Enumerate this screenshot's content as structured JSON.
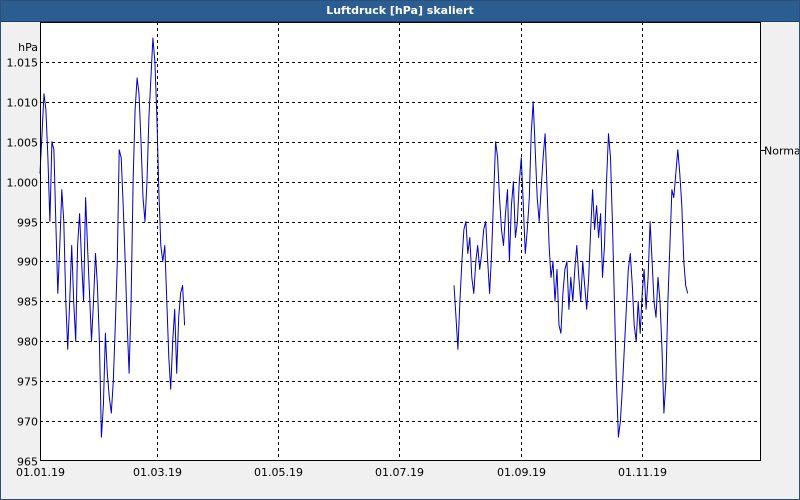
{
  "window": {
    "title": "Luftdruck [hPa] skaliert"
  },
  "colors": {
    "line": "#0000c8",
    "grid": "#000000",
    "titlebar": "#2b5d91",
    "plot_background": "#ffffff",
    "window_background": "#f0f0f0"
  },
  "chart_data": {
    "type": "line",
    "title": "Luftdruck [hPa] skaliert",
    "ylabel": "hPa",
    "xlabel": "",
    "ylim": [
      965,
      1020
    ],
    "xlim": [
      "2019-01-01",
      "2019-12-31"
    ],
    "grid": true,
    "x_ticks": [
      "01.01.19",
      "01.03.19",
      "01.05.19",
      "01.07.19",
      "01.09.19",
      "01.11.19"
    ],
    "y_ticks": [
      "965",
      "970",
      "975",
      "980",
      "985",
      "990",
      "995",
      "1.000",
      "1.005",
      "1.010",
      "1.015"
    ],
    "reference_lines": [
      {
        "label": "Normal",
        "value": 1004
      }
    ],
    "series": [
      {
        "values": [
          [
            [
              "2019-01-01",
              1001
            ],
            [
              "2019-01-02",
              1006
            ],
            [
              "2019-01-03",
              1011
            ],
            [
              "2019-01-04",
              1009
            ],
            [
              "2019-01-05",
              1003
            ],
            [
              "2019-01-06",
              995
            ],
            [
              "2019-01-07",
              1005
            ],
            [
              "2019-01-08",
              1004
            ],
            [
              "2019-01-09",
              995
            ],
            [
              "2019-01-10",
              986
            ],
            [
              "2019-01-11",
              992
            ],
            [
              "2019-01-12",
              999
            ],
            [
              "2019-01-13",
              995
            ],
            [
              "2019-01-14",
              985
            ],
            [
              "2019-01-15",
              979
            ],
            [
              "2019-01-16",
              985
            ],
            [
              "2019-01-17",
              992
            ],
            [
              "2019-01-18",
              985
            ],
            [
              "2019-01-19",
              980
            ],
            [
              "2019-01-20",
              992
            ],
            [
              "2019-01-21",
              996
            ],
            [
              "2019-01-22",
              990
            ],
            [
              "2019-01-23",
              985
            ],
            [
              "2019-01-24",
              998
            ],
            [
              "2019-01-25",
              992
            ],
            [
              "2019-01-26",
              986
            ],
            [
              "2019-01-27",
              980
            ],
            [
              "2019-01-28",
              985
            ],
            [
              "2019-01-29",
              991
            ],
            [
              "2019-01-30",
              987
            ],
            [
              "2019-01-31",
              980
            ],
            [
              "2019-02-01",
              968
            ],
            [
              "2019-02-02",
              972
            ],
            [
              "2019-02-03",
              981
            ],
            [
              "2019-02-04",
              976
            ],
            [
              "2019-02-05",
              973
            ],
            [
              "2019-02-06",
              971
            ],
            [
              "2019-02-07",
              975
            ],
            [
              "2019-02-08",
              982
            ],
            [
              "2019-02-09",
              990
            ],
            [
              "2019-02-10",
              1004
            ],
            [
              "2019-02-11",
              1003
            ],
            [
              "2019-02-12",
              997
            ],
            [
              "2019-02-13",
              990
            ],
            [
              "2019-02-14",
              982
            ],
            [
              "2019-02-15",
              976
            ],
            [
              "2019-02-16",
              985
            ],
            [
              "2019-02-17",
              1000
            ],
            [
              "2019-02-18",
              1009
            ],
            [
              "2019-02-19",
              1013
            ],
            [
              "2019-02-20",
              1011
            ],
            [
              "2019-02-21",
              1005
            ],
            [
              "2019-02-22",
              998
            ],
            [
              "2019-02-23",
              995
            ],
            [
              "2019-02-24",
              1000
            ],
            [
              "2019-02-25",
              1008
            ],
            [
              "2019-02-26",
              1013
            ],
            [
              "2019-02-27",
              1018
            ],
            [
              "2019-02-28",
              1015
            ],
            [
              "2019-03-01",
              1008
            ],
            [
              "2019-03-02",
              999
            ],
            [
              "2019-03-03",
              992
            ],
            [
              "2019-03-04",
              990
            ],
            [
              "2019-03-05",
              992
            ],
            [
              "2019-03-06",
              985
            ],
            [
              "2019-03-07",
              978
            ],
            [
              "2019-03-08",
              974
            ],
            [
              "2019-03-09",
              980
            ],
            [
              "2019-03-10",
              984
            ],
            [
              "2019-03-11",
              976
            ],
            [
              "2019-03-12",
              983
            ],
            [
              "2019-03-13",
              986
            ],
            [
              "2019-03-14",
              987
            ],
            [
              "2019-03-15",
              982
            ]
          ],
          [
            [
              "2019-07-29",
              987
            ],
            [
              "2019-07-30",
              983
            ],
            [
              "2019-07-31",
              979
            ],
            [
              "2019-08-01",
              985
            ],
            [
              "2019-08-02",
              990
            ],
            [
              "2019-08-03",
              994
            ],
            [
              "2019-08-04",
              995
            ],
            [
              "2019-08-05",
              991
            ],
            [
              "2019-08-06",
              993
            ],
            [
              "2019-08-07",
              988
            ],
            [
              "2019-08-08",
              986
            ],
            [
              "2019-08-09",
              990
            ],
            [
              "2019-08-10",
              992
            ],
            [
              "2019-08-11",
              989
            ],
            [
              "2019-08-12",
              991
            ],
            [
              "2019-08-13",
              994
            ],
            [
              "2019-08-14",
              995
            ],
            [
              "2019-08-15",
              990
            ],
            [
              "2019-08-16",
              986
            ],
            [
              "2019-08-17",
              991
            ],
            [
              "2019-08-18",
              998
            ],
            [
              "2019-08-19",
              1005
            ],
            [
              "2019-08-20",
              1003
            ],
            [
              "2019-08-21",
              998
            ],
            [
              "2019-08-22",
              994
            ],
            [
              "2019-08-23",
              992
            ],
            [
              "2019-08-24",
              996
            ],
            [
              "2019-08-25",
              999
            ],
            [
              "2019-08-26",
              990
            ],
            [
              "2019-08-27",
              997
            ],
            [
              "2019-08-28",
              1000
            ],
            [
              "2019-08-29",
              993
            ],
            [
              "2019-08-30",
              995
            ],
            [
              "2019-08-31",
              1000
            ],
            [
              "2019-09-01",
              1003
            ],
            [
              "2019-09-02",
              997
            ],
            [
              "2019-09-03",
              991
            ],
            [
              "2019-09-04",
              994
            ],
            [
              "2019-09-05",
              998
            ],
            [
              "2019-09-06",
              1006
            ],
            [
              "2019-09-07",
              1010
            ],
            [
              "2019-09-08",
              1004
            ],
            [
              "2019-09-09",
              998
            ],
            [
              "2019-09-10",
              995
            ],
            [
              "2019-09-11",
              999
            ],
            [
              "2019-09-12",
              1003
            ],
            [
              "2019-09-13",
              1006
            ],
            [
              "2019-09-14",
              999
            ],
            [
              "2019-09-15",
              992
            ],
            [
              "2019-09-16",
              988
            ],
            [
              "2019-09-17",
              990
            ],
            [
              "2019-09-18",
              985
            ],
            [
              "2019-09-19",
              989
            ],
            [
              "2019-09-20",
              982
            ],
            [
              "2019-09-21",
              981
            ],
            [
              "2019-09-22",
              986
            ],
            [
              "2019-09-23",
              989
            ],
            [
              "2019-09-24",
              990
            ],
            [
              "2019-09-25",
              984
            ],
            [
              "2019-09-26",
              988
            ],
            [
              "2019-09-27",
              985
            ],
            [
              "2019-09-28",
              989
            ],
            [
              "2019-09-29",
              992
            ],
            [
              "2019-09-30",
              988
            ],
            [
              "2019-10-01",
              985
            ],
            [
              "2019-10-02",
              990
            ],
            [
              "2019-10-03",
              987
            ],
            [
              "2019-10-04",
              984
            ],
            [
              "2019-10-05",
              988
            ],
            [
              "2019-10-06",
              994
            ],
            [
              "2019-10-07",
              999
            ],
            [
              "2019-10-08",
              994
            ],
            [
              "2019-10-09",
              997
            ],
            [
              "2019-10-10",
              993
            ],
            [
              "2019-10-11",
              996
            ],
            [
              "2019-10-12",
              988
            ],
            [
              "2019-10-13",
              992
            ],
            [
              "2019-10-14",
              1000
            ],
            [
              "2019-10-15",
              1006
            ],
            [
              "2019-10-16",
              1003
            ],
            [
              "2019-10-17",
              995
            ],
            [
              "2019-10-18",
              985
            ],
            [
              "2019-10-19",
              975
            ],
            [
              "2019-10-20",
              968
            ],
            [
              "2019-10-21",
              970
            ],
            [
              "2019-10-22",
              974
            ],
            [
              "2019-10-23",
              979
            ],
            [
              "2019-10-24",
              984
            ],
            [
              "2019-10-25",
              989
            ],
            [
              "2019-10-26",
              991
            ],
            [
              "2019-10-27",
              987
            ],
            [
              "2019-10-28",
              982
            ],
            [
              "2019-10-29",
              980
            ],
            [
              "2019-10-30",
              985
            ],
            [
              "2019-10-31",
              981
            ],
            [
              "2019-11-01",
              986
            ],
            [
              "2019-11-02",
              989
            ],
            [
              "2019-11-03",
              984
            ],
            [
              "2019-11-04",
              988
            ],
            [
              "2019-11-05",
              995
            ],
            [
              "2019-11-06",
              990
            ],
            [
              "2019-11-07",
              985
            ],
            [
              "2019-11-08",
              983
            ],
            [
              "2019-11-09",
              988
            ],
            [
              "2019-11-10",
              985
            ],
            [
              "2019-11-11",
              979
            ],
            [
              "2019-11-12",
              971
            ],
            [
              "2019-11-13",
              975
            ],
            [
              "2019-11-14",
              985
            ],
            [
              "2019-11-15",
              992
            ],
            [
              "2019-11-16",
              999
            ],
            [
              "2019-11-17",
              998
            ],
            [
              "2019-11-18",
              1001
            ],
            [
              "2019-11-19",
              1004
            ],
            [
              "2019-11-20",
              1001
            ],
            [
              "2019-11-21",
              997
            ],
            [
              "2019-11-22",
              990
            ],
            [
              "2019-11-23",
              987
            ],
            [
              "2019-11-24",
              986
            ]
          ]
        ]
      }
    ]
  }
}
